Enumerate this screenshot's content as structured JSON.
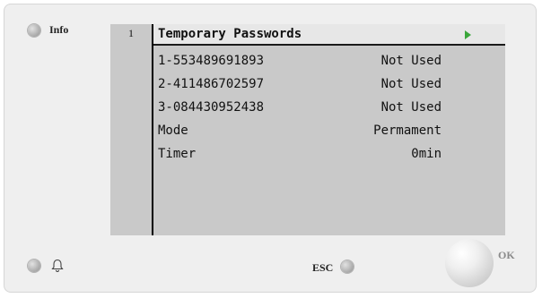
{
  "buttons": {
    "info_label": "Info",
    "esc_label": "ESC",
    "ok_label": "OK"
  },
  "screen": {
    "page_number": "1",
    "title": "Temporary Passwords",
    "rows": [
      {
        "label": "1-553489691893",
        "value": "Not Used"
      },
      {
        "label": "2-411486702597",
        "value": "Not Used"
      },
      {
        "label": "3-084430952438",
        "value": "Not Used"
      },
      {
        "label": "Mode",
        "value": "Permament"
      },
      {
        "label": "Timer",
        "value": "0min"
      }
    ]
  },
  "icons": {
    "alarm": "bell-icon",
    "next": "arrow-right-icon"
  },
  "colors": {
    "screen_bg": "#c9c9c9",
    "header_bg": "#e7e7e7",
    "arrow": "#3aa63a",
    "panel_bg": "#efefef"
  }
}
